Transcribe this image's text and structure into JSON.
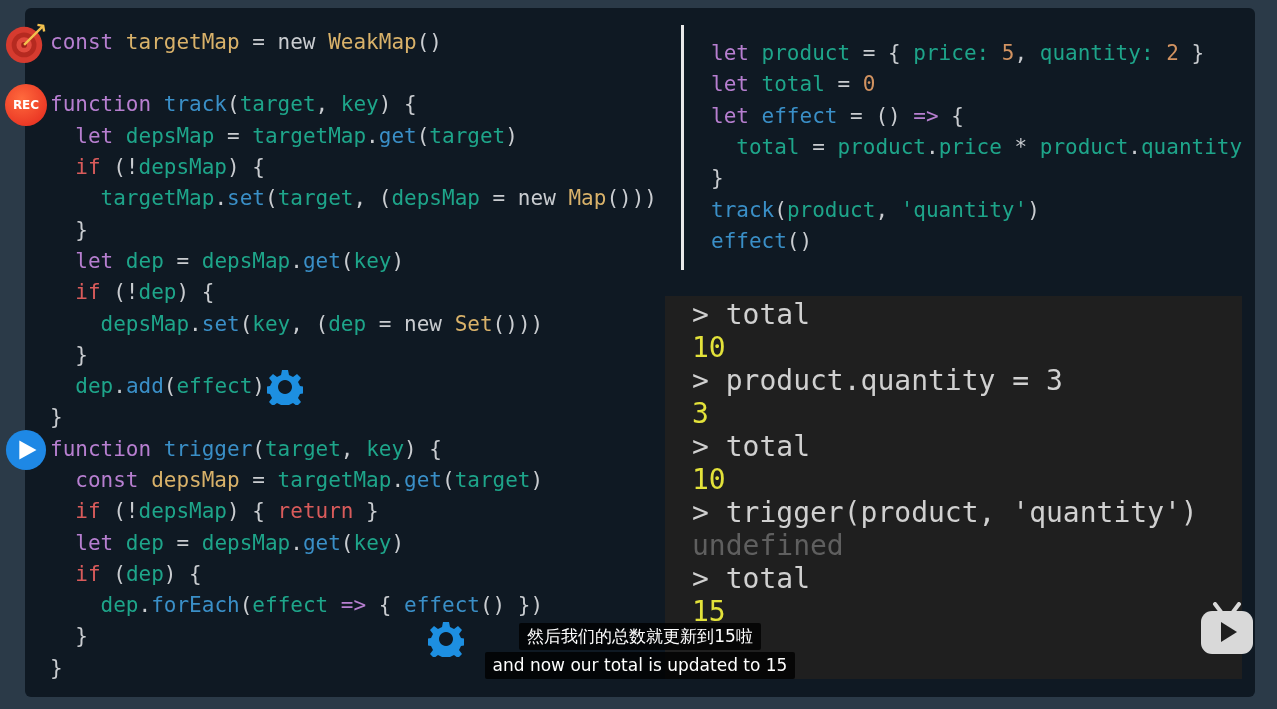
{
  "left_code": {
    "blocks": [
      {
        "lines": [
          {
            "marker": {
              "kind": "target"
            },
            "tokens": [
              {
                "kind": "kw",
                "text": "const"
              },
              {
                "kind": "fn",
                "text": " targetMap"
              },
              {
                "kind": "op",
                "text": " = new "
              },
              {
                "kind": "fn",
                "text": "WeakMap"
              },
              {
                "kind": "op",
                "text": "()"
              }
            ]
          }
        ]
      },
      {
        "lines": [
          {
            "marker": {
              "kind": "rec",
              "text": "REC"
            },
            "tokens": [
              {
                "kind": "kw",
                "text": "function"
              },
              {
                "kind": "call",
                "text": " track"
              },
              {
                "kind": "op",
                "text": "("
              },
              {
                "kind": "id",
                "text": "target"
              },
              {
                "kind": "op",
                "text": ", "
              },
              {
                "kind": "id",
                "text": "key"
              },
              {
                "kind": "op",
                "text": ") {"
              }
            ]
          },
          {
            "tokens": [
              {
                "kind": "kw",
                "text": "  let"
              },
              {
                "kind": "id",
                "text": " depsMap"
              },
              {
                "kind": "op",
                "text": " = "
              },
              {
                "kind": "id",
                "text": "targetMap"
              },
              {
                "kind": "op",
                "text": "."
              },
              {
                "kind": "call",
                "text": "get"
              },
              {
                "kind": "op",
                "text": "("
              },
              {
                "kind": "id",
                "text": "target"
              },
              {
                "kind": "op",
                "text": ")"
              }
            ]
          },
          {
            "tokens": [
              {
                "kind": "ctl",
                "text": "  if"
              },
              {
                "kind": "op",
                "text": " (!"
              },
              {
                "kind": "id",
                "text": "depsMap"
              },
              {
                "kind": "op",
                "text": ") {"
              }
            ]
          },
          {
            "tokens": [
              {
                "kind": "id",
                "text": "    targetMap"
              },
              {
                "kind": "op",
                "text": "."
              },
              {
                "kind": "call",
                "text": "set"
              },
              {
                "kind": "op",
                "text": "("
              },
              {
                "kind": "id",
                "text": "target"
              },
              {
                "kind": "op",
                "text": ", ("
              },
              {
                "kind": "id",
                "text": "depsMap"
              },
              {
                "kind": "op",
                "text": " = new "
              },
              {
                "kind": "fn",
                "text": "Map"
              },
              {
                "kind": "op",
                "text": "()))"
              }
            ]
          },
          {
            "tokens": [
              {
                "kind": "op",
                "text": "  }"
              }
            ]
          },
          {
            "tokens": [
              {
                "kind": "kw",
                "text": "  let"
              },
              {
                "kind": "id",
                "text": " dep"
              },
              {
                "kind": "op",
                "text": " = "
              },
              {
                "kind": "id",
                "text": "depsMap"
              },
              {
                "kind": "op",
                "text": "."
              },
              {
                "kind": "call",
                "text": "get"
              },
              {
                "kind": "op",
                "text": "("
              },
              {
                "kind": "id",
                "text": "key"
              },
              {
                "kind": "op",
                "text": ")"
              }
            ]
          },
          {
            "tokens": [
              {
                "kind": "ctl",
                "text": "  if"
              },
              {
                "kind": "op",
                "text": " (!"
              },
              {
                "kind": "id",
                "text": "dep"
              },
              {
                "kind": "op",
                "text": ") {"
              }
            ]
          },
          {
            "tokens": [
              {
                "kind": "id",
                "text": "    depsMap"
              },
              {
                "kind": "op",
                "text": "."
              },
              {
                "kind": "call",
                "text": "set"
              },
              {
                "kind": "op",
                "text": "("
              },
              {
                "kind": "id",
                "text": "key"
              },
              {
                "kind": "op",
                "text": ", ("
              },
              {
                "kind": "id",
                "text": "dep"
              },
              {
                "kind": "op",
                "text": " = new "
              },
              {
                "kind": "fn",
                "text": "Set"
              },
              {
                "kind": "op",
                "text": "()))"
              }
            ]
          },
          {
            "tokens": [
              {
                "kind": "op",
                "text": "  }"
              }
            ]
          },
          {
            "trailing": {
              "kind": "gear"
            },
            "tokens": [
              {
                "kind": "id",
                "text": "  dep"
              },
              {
                "kind": "op",
                "text": "."
              },
              {
                "kind": "call",
                "text": "add"
              },
              {
                "kind": "op",
                "text": "("
              },
              {
                "kind": "id",
                "text": "effect"
              },
              {
                "kind": "op",
                "text": ")"
              }
            ]
          },
          {
            "tokens": [
              {
                "kind": "op",
                "text": "}"
              }
            ]
          },
          {
            "marker": {
              "kind": "play"
            },
            "tokens": [
              {
                "kind": "kw",
                "text": "function"
              },
              {
                "kind": "call",
                "text": " trigger"
              },
              {
                "kind": "op",
                "text": "("
              },
              {
                "kind": "id",
                "text": "target"
              },
              {
                "kind": "op",
                "text": ", "
              },
              {
                "kind": "id",
                "text": "key"
              },
              {
                "kind": "op",
                "text": ") {"
              }
            ]
          },
          {
            "tokens": [
              {
                "kind": "kw",
                "text": "  const"
              },
              {
                "kind": "fn",
                "text": " depsMap"
              },
              {
                "kind": "op",
                "text": " = "
              },
              {
                "kind": "id",
                "text": "targetMap"
              },
              {
                "kind": "op",
                "text": "."
              },
              {
                "kind": "call",
                "text": "get"
              },
              {
                "kind": "op",
                "text": "("
              },
              {
                "kind": "id",
                "text": "target"
              },
              {
                "kind": "op",
                "text": ")"
              }
            ]
          },
          {
            "tokens": [
              {
                "kind": "ctl",
                "text": "  if"
              },
              {
                "kind": "op",
                "text": " (!"
              },
              {
                "kind": "id",
                "text": "depsMap"
              },
              {
                "kind": "op",
                "text": ") { "
              },
              {
                "kind": "ctl",
                "text": "return"
              },
              {
                "kind": "op",
                "text": " }"
              }
            ]
          },
          {
            "tokens": [
              {
                "kind": "kw",
                "text": "  let"
              },
              {
                "kind": "id",
                "text": " dep"
              },
              {
                "kind": "op",
                "text": " = "
              },
              {
                "kind": "id",
                "text": "depsMap"
              },
              {
                "kind": "op",
                "text": "."
              },
              {
                "kind": "call",
                "text": "get"
              },
              {
                "kind": "op",
                "text": "("
              },
              {
                "kind": "id",
                "text": "key"
              },
              {
                "kind": "op",
                "text": ")"
              }
            ]
          },
          {
            "tokens": [
              {
                "kind": "ctl",
                "text": "  if"
              },
              {
                "kind": "op",
                "text": " ("
              },
              {
                "kind": "id",
                "text": "dep"
              },
              {
                "kind": "op",
                "text": ") {"
              }
            ]
          },
          {
            "tokens": [
              {
                "kind": "id",
                "text": "    dep"
              },
              {
                "kind": "op",
                "text": "."
              },
              {
                "kind": "call",
                "text": "forEach"
              },
              {
                "kind": "op",
                "text": "("
              },
              {
                "kind": "id",
                "text": "effect"
              },
              {
                "kind": "kw",
                "text": " =>"
              },
              {
                "kind": "op",
                "text": " { "
              },
              {
                "kind": "call",
                "text": "effect"
              },
              {
                "kind": "op",
                "text": "() })"
              }
            ]
          },
          {
            "tokens": [
              {
                "kind": "op",
                "text": "  }"
              }
            ]
          },
          {
            "tokens": [
              {
                "kind": "op",
                "text": "}"
              }
            ]
          }
        ]
      }
    ]
  },
  "right_code": {
    "lines": [
      {
        "tokens": [
          {
            "kind": "kw",
            "text": "let"
          },
          {
            "kind": "id",
            "text": " product"
          },
          {
            "kind": "op",
            "text": " = { "
          },
          {
            "kind": "id",
            "text": "price:"
          },
          {
            "kind": "num",
            "text": " 5"
          },
          {
            "kind": "op",
            "text": ", "
          },
          {
            "kind": "id",
            "text": "quantity:"
          },
          {
            "kind": "num",
            "text": " 2"
          },
          {
            "kind": "op",
            "text": " }"
          }
        ]
      },
      {
        "tokens": [
          {
            "kind": "kw",
            "text": "let"
          },
          {
            "kind": "id",
            "text": " total"
          },
          {
            "kind": "op",
            "text": " = "
          },
          {
            "kind": "num",
            "text": "0"
          }
        ]
      },
      {
        "tokens": [
          {
            "kind": "kw",
            "text": "let"
          },
          {
            "kind": "call",
            "text": " effect"
          },
          {
            "kind": "op",
            "text": " = () "
          },
          {
            "kind": "kw",
            "text": "=>"
          },
          {
            "kind": "op",
            "text": " {"
          }
        ]
      },
      {
        "tokens": [
          {
            "kind": "id",
            "text": "  total"
          },
          {
            "kind": "op",
            "text": " = "
          },
          {
            "kind": "id",
            "text": "product"
          },
          {
            "kind": "op",
            "text": "."
          },
          {
            "kind": "id",
            "text": "price"
          },
          {
            "kind": "op",
            "text": " * "
          },
          {
            "kind": "id",
            "text": "product"
          },
          {
            "kind": "op",
            "text": "."
          },
          {
            "kind": "id",
            "text": "quantity"
          }
        ]
      },
      {
        "tokens": [
          {
            "kind": "op",
            "text": "}"
          }
        ]
      },
      {
        "tokens": [
          {
            "kind": "call",
            "text": "track"
          },
          {
            "kind": "op",
            "text": "("
          },
          {
            "kind": "id",
            "text": "product"
          },
          {
            "kind": "op",
            "text": ", "
          },
          {
            "kind": "id",
            "text": "'quantity'"
          },
          {
            "kind": "op",
            "text": ")"
          }
        ]
      },
      {
        "tokens": [
          {
            "kind": "call",
            "text": "effect"
          },
          {
            "kind": "op",
            "text": "()"
          }
        ]
      }
    ]
  },
  "console": {
    "lines": [
      {
        "kind": "input",
        "text": "> total"
      },
      {
        "kind": "result",
        "text": "10"
      },
      {
        "kind": "input",
        "text": "> product.quantity = 3"
      },
      {
        "kind": "result",
        "text": "3"
      },
      {
        "kind": "input",
        "text": "> total"
      },
      {
        "kind": "result",
        "text": "10"
      },
      {
        "kind": "input",
        "text": "> trigger(product, 'quantity')"
      },
      {
        "kind": "undefined",
        "text": "undefined"
      },
      {
        "kind": "input",
        "text": "> total"
      },
      {
        "kind": "result",
        "text": "15"
      }
    ]
  },
  "subtitles": [
    "然后我们的总数就更新到15啦",
    "and now our total is updated to 15"
  ]
}
